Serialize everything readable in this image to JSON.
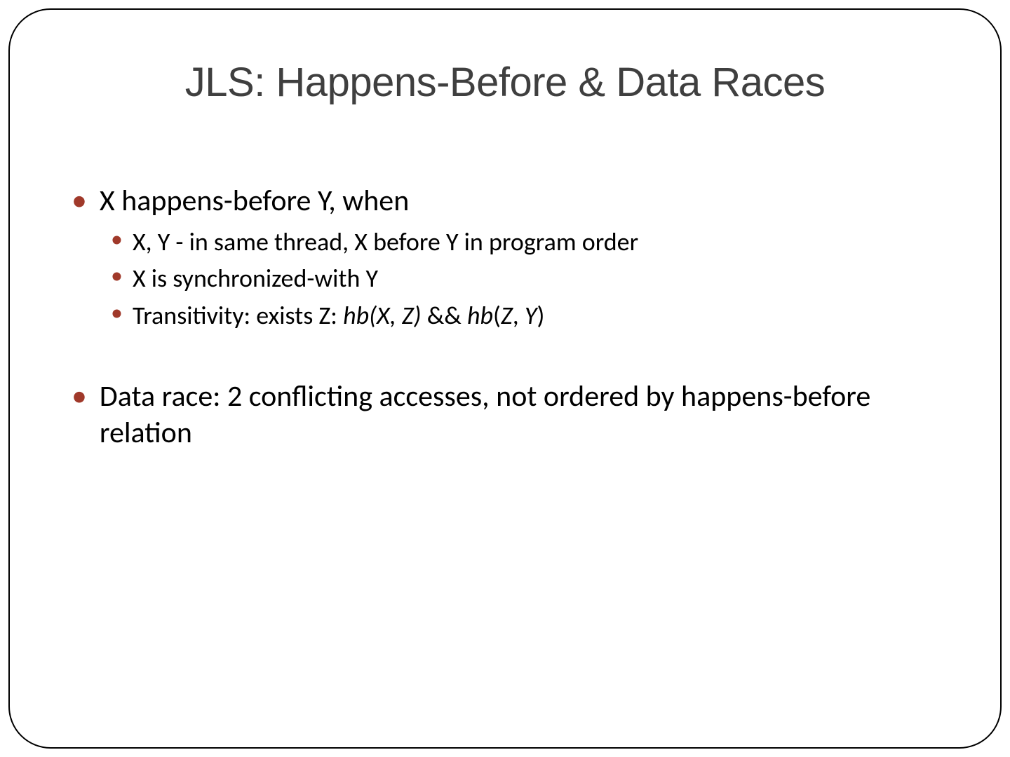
{
  "title": "JLS: Happens-Before & Data Races",
  "bullets": {
    "b1": "X happens-before Y, when",
    "b1_1": "X, Y - in same thread, X before Y in program order",
    "b1_2": "X is synchronized-with Y",
    "b1_3_pre": "Transitivity: exists Z: ",
    "b1_3_i1": "hb(X, Z)",
    "b1_3_mid": " && ",
    "b1_3_i2": "hb",
    "b1_3_paren_open": "(",
    "b1_3_i3": "Z",
    "b1_3_comma": ", ",
    "b1_3_i4": "Y",
    "b1_3_paren_close": ")",
    "b2": "Data race: 2 conflicting accesses, not ordered by happens-before relation"
  }
}
